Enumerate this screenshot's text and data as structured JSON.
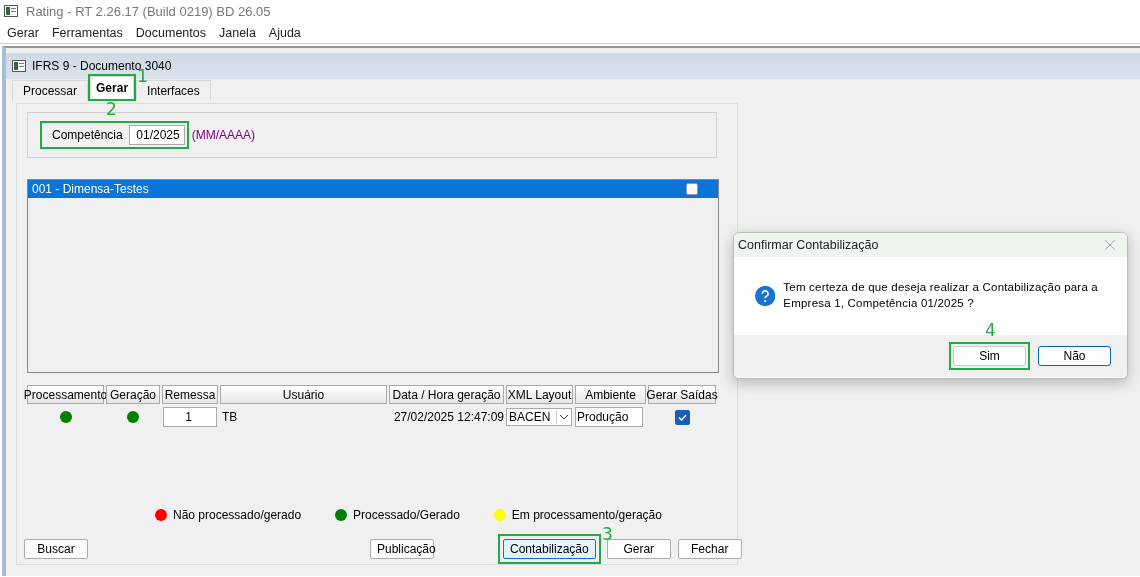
{
  "app": {
    "title": "Rating - RT 2.26.17 (Build 0219) BD 26.05"
  },
  "menu": [
    "Gerar",
    "Ferramentas",
    "Documentos",
    "Janela",
    "Ajuda"
  ],
  "window": {
    "title": "IFRS 9 - Documento 3040"
  },
  "tabs": [
    {
      "label": "Processar",
      "selected": false
    },
    {
      "label": "Gerar",
      "selected": true,
      "annotation": "1"
    },
    {
      "label": "Interfaces",
      "selected": false
    }
  ],
  "competencia": {
    "label": "Competência",
    "value": "01/2025",
    "hint": "(MM/AAAA)",
    "annotation": "2"
  },
  "companies": [
    {
      "label": "001 - Dimensa-Testes",
      "selected": true,
      "checked": false
    }
  ],
  "table": {
    "columns": [
      "Processamento",
      "Geração",
      "Remessa",
      "Usuário",
      "Data / Hora geração",
      "XML Layout",
      "Ambiente",
      "Gerar Saídas"
    ],
    "rows": [
      {
        "processamento": {
          "color": "#008000"
        },
        "geracao": {
          "color": "#008000"
        },
        "remessa": "1",
        "usuario": "TB",
        "data_hora": "27/02/2025 12:47:09",
        "xml_layout": "BACEN",
        "ambiente": "Produção",
        "gerar_saidas": true
      }
    ]
  },
  "legend": [
    {
      "label": "Não processado/gerado",
      "color": "#ff0000"
    },
    {
      "label": "Processado/Gerado",
      "color": "#008000"
    },
    {
      "label": "Em processamento/geração",
      "color": "#ffff00"
    }
  ],
  "buttons": [
    {
      "label": "Buscar"
    },
    {
      "label": "Publicação"
    },
    {
      "label": "Contabilização",
      "focused": true,
      "annotation": "3"
    },
    {
      "label": "Gerar"
    },
    {
      "label": "Fechar"
    }
  ],
  "dialog": {
    "title": "Confirmar Contabilização",
    "message": "Tem certeza de que deseja realizar a Contabilização para a Empresa 1, Competência 01/2025 ?",
    "buttons": [
      {
        "label": "Sim",
        "annotation": "4"
      },
      {
        "label": "Não",
        "default": true
      }
    ]
  }
}
